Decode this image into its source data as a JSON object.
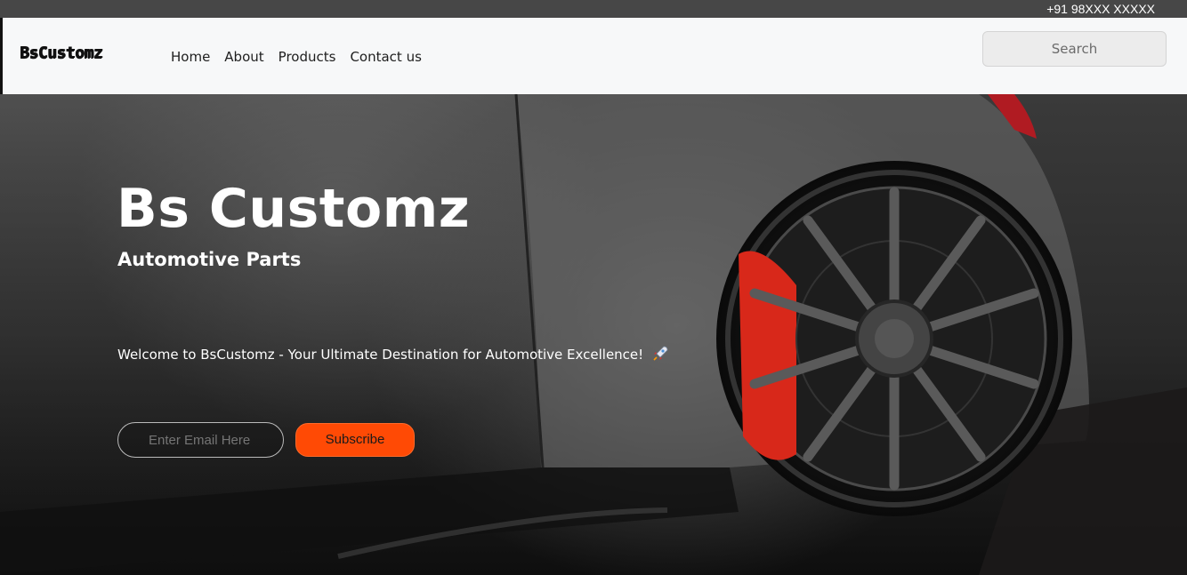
{
  "topbar": {
    "phone": "+91 98XXX XXXXX"
  },
  "nav": {
    "brand": "BsCustomz",
    "links": [
      "Home",
      "About",
      "Products",
      "Contact us"
    ],
    "search_placeholder": "Search"
  },
  "hero": {
    "title": "Bs Customz",
    "subtitle": "Automotive Parts",
    "welcome": "Welcome to BsCustomz - Your Ultimate Destination for Automotive Excellence!",
    "email_placeholder": "Enter Email Here",
    "subscribe_label": "Subscribe"
  },
  "colors": {
    "accent": "#ff4a05",
    "topbar": "#474747",
    "navbar": "#f7f8f9"
  },
  "icons": {
    "welcome_emoji": "rocket-icon"
  }
}
